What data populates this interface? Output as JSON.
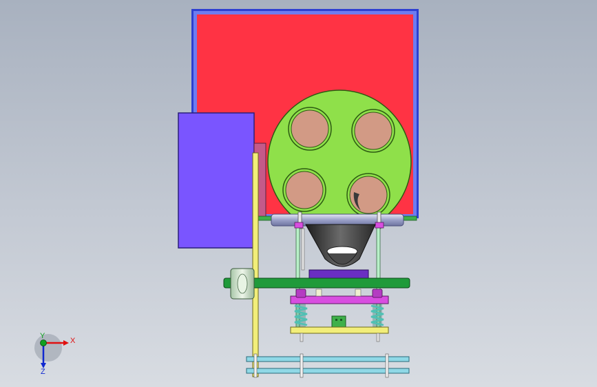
{
  "viewport": {
    "background_top": "#a8b1bf",
    "background_bottom": "#d8dce2"
  },
  "model": {
    "colors": {
      "red_panel": "#ff3344",
      "frame_blue": "#2d3fd1",
      "motor_box": "#7a55ff",
      "disc": "#8fe04a",
      "holes": "#d29a85",
      "shaft_green": "#1f9a3a",
      "yellow_plate": "#f2ee7a",
      "magenta_plate": "#d84ee0",
      "purple_block": "#6a2ec2",
      "spring": "#4fc1b4",
      "rail_cyan": "#8fd8e6",
      "funnel_dark": "#3a3a3a",
      "bracket_green": "#3fb04a"
    }
  },
  "triad": {
    "x_label": "X",
    "y_label": "Y",
    "z_label": "Z",
    "x_color": "#e01010",
    "y_color": "#10a020",
    "z_color": "#1028d0"
  }
}
